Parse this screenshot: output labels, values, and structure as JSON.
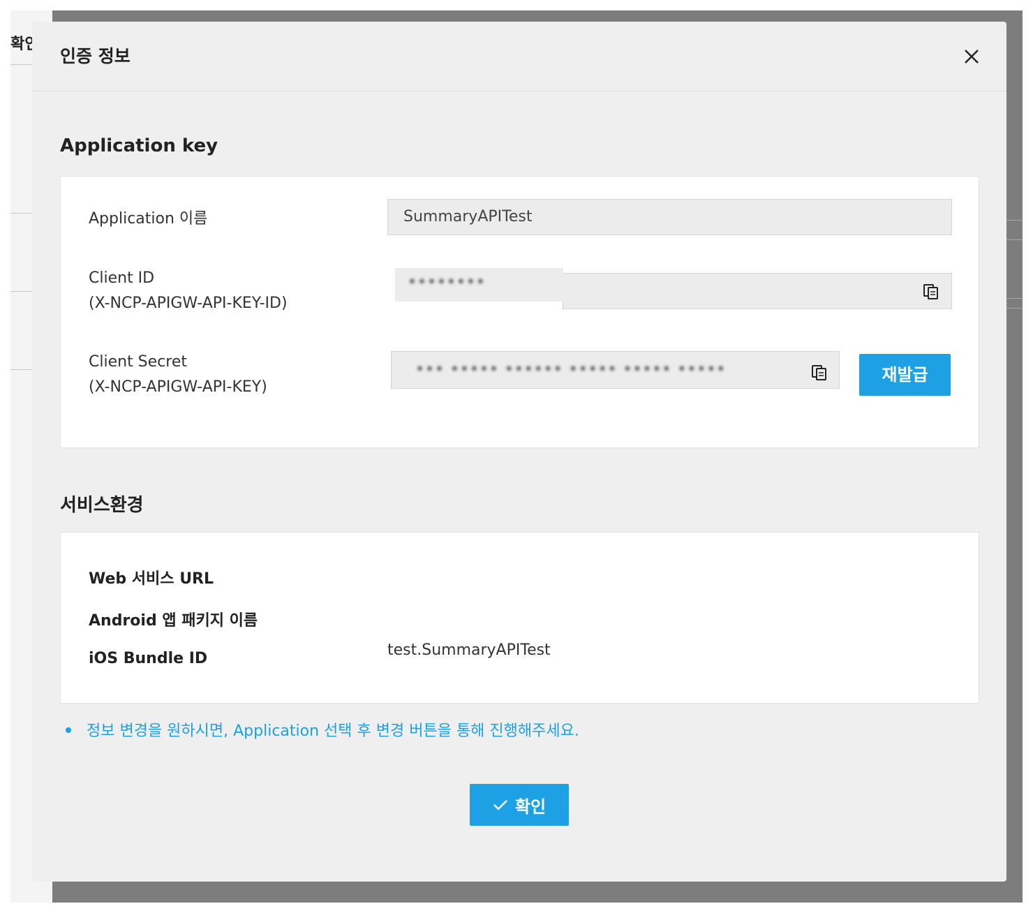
{
  "background": {
    "confirm_label": "확인"
  },
  "modal": {
    "title": "인증 정보",
    "close_icon": "close-icon"
  },
  "application_key": {
    "section_title": "Application key",
    "app_name_label": "Application 이름",
    "app_name_value": "SummaryAPITest",
    "client_id_label_line1": "Client ID",
    "client_id_label_line2": "(X-NCP-APIGW-API-KEY-ID)",
    "client_id_value": "••••••••",
    "client_secret_label_line1": "Client Secret",
    "client_secret_label_line2": "(X-NCP-APIGW-API-KEY)",
    "client_secret_value": "••• ••••• •••••• ••••• ••••• •••••",
    "copy_icon": "copy-icon",
    "reissue_button": "재발급"
  },
  "service_env": {
    "section_title": "서비스환경",
    "web_url_label": "Web 서비스 URL",
    "android_label": "Android 앱 패키지 이름",
    "ios_label": "iOS Bundle ID",
    "ios_value": "test.SummaryAPITest"
  },
  "notice": "정보 변경을 원하시면, Application 선택 후 변경 버튼을 통해 진행해주세요.",
  "ok_button": "확인",
  "colors": {
    "accent": "#1da1e4",
    "overlay": "#7d7d7d",
    "modal_bg": "#efefef"
  }
}
